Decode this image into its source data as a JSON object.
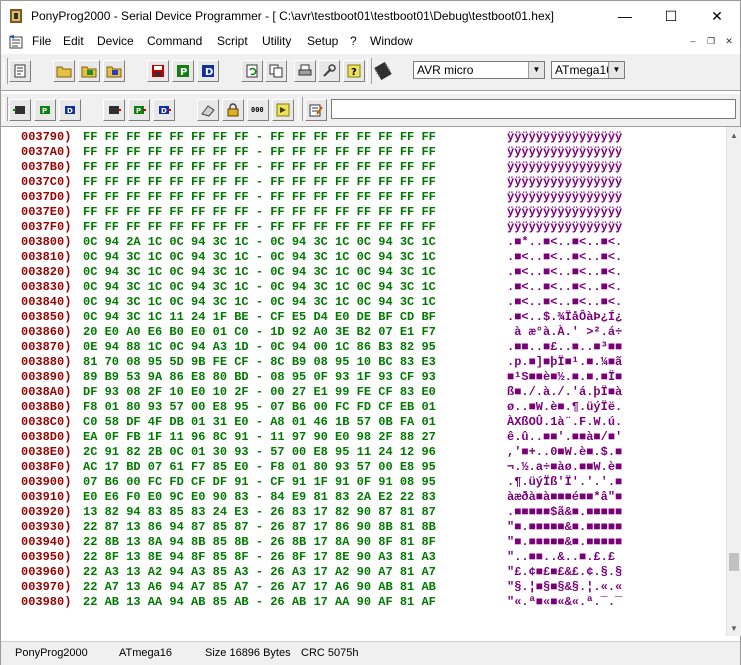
{
  "window": {
    "title": "PonyProg2000 - Serial Device Programmer - [ C:\\avr\\testboot01\\testboot01\\Debug\\testboot01.hex]",
    "minimize": "—",
    "maximize": "☐",
    "close": "✕"
  },
  "menu": {
    "items": [
      "File",
      "Edit",
      "Device",
      "Command",
      "Script",
      "Utility",
      "Setup",
      "?",
      "Window"
    ],
    "mdi_minimize": "–",
    "mdi_restore": "❐",
    "mdi_close": "✕"
  },
  "toolbar": {
    "device_family": "AVR micro",
    "device_type": "ATmega16"
  },
  "hex_rows": [
    {
      "addr": "003790)",
      "bytes": "FF FF FF FF FF FF FF FF - FF FF FF FF FF FF FF FF",
      "ascii": "ÿÿÿÿÿÿÿÿÿÿÿÿÿÿÿÿ"
    },
    {
      "addr": "0037A0)",
      "bytes": "FF FF FF FF FF FF FF FF - FF FF FF FF FF FF FF FF",
      "ascii": "ÿÿÿÿÿÿÿÿÿÿÿÿÿÿÿÿ"
    },
    {
      "addr": "0037B0)",
      "bytes": "FF FF FF FF FF FF FF FF - FF FF FF FF FF FF FF FF",
      "ascii": "ÿÿÿÿÿÿÿÿÿÿÿÿÿÿÿÿ"
    },
    {
      "addr": "0037C0)",
      "bytes": "FF FF FF FF FF FF FF FF - FF FF FF FF FF FF FF FF",
      "ascii": "ÿÿÿÿÿÿÿÿÿÿÿÿÿÿÿÿ"
    },
    {
      "addr": "0037D0)",
      "bytes": "FF FF FF FF FF FF FF FF - FF FF FF FF FF FF FF FF",
      "ascii": "ÿÿÿÿÿÿÿÿÿÿÿÿÿÿÿÿ"
    },
    {
      "addr": "0037E0)",
      "bytes": "FF FF FF FF FF FF FF FF - FF FF FF FF FF FF FF FF",
      "ascii": "ÿÿÿÿÿÿÿÿÿÿÿÿÿÿÿÿ"
    },
    {
      "addr": "0037F0)",
      "bytes": "FF FF FF FF FF FF FF FF - FF FF FF FF FF FF FF FF",
      "ascii": "ÿÿÿÿÿÿÿÿÿÿÿÿÿÿÿÿ"
    },
    {
      "addr": "003800)",
      "bytes": "0C 94 2A 1C 0C 94 3C 1C - 0C 94 3C 1C 0C 94 3C 1C",
      "ascii": ".■*..■<..■<..■<."
    },
    {
      "addr": "003810)",
      "bytes": "0C 94 3C 1C 0C 94 3C 1C - 0C 94 3C 1C 0C 94 3C 1C",
      "ascii": ".■<..■<..■<..■<."
    },
    {
      "addr": "003820)",
      "bytes": "0C 94 3C 1C 0C 94 3C 1C - 0C 94 3C 1C 0C 94 3C 1C",
      "ascii": ".■<..■<..■<..■<."
    },
    {
      "addr": "003830)",
      "bytes": "0C 94 3C 1C 0C 94 3C 1C - 0C 94 3C 1C 0C 94 3C 1C",
      "ascii": ".■<..■<..■<..■<."
    },
    {
      "addr": "003840)",
      "bytes": "0C 94 3C 1C 0C 94 3C 1C - 0C 94 3C 1C 0C 94 3C 1C",
      "ascii": ".■<..■<..■<..■<."
    },
    {
      "addr": "003850)",
      "bytes": "0C 94 3C 1C 11 24 1F BE - CF E5 D4 E0 DE BF CD BF",
      "ascii": ".■<..$.¾ÏåÔàÞ¿Í¿"
    },
    {
      "addr": "003860)",
      "bytes": "20 E0 A0 E6 B0 E0 01 C0 - 1D 92 A0 3E B2 07 E1 F7",
      "ascii": " à æ°à.À.' >².á÷"
    },
    {
      "addr": "003870)",
      "bytes": "0E 94 88 1C 0C 94 A3 1D - 0C 94 00 1C 86 B3 82 95",
      "ascii": ".■■..■£..■..■³■■"
    },
    {
      "addr": "003880)",
      "bytes": "81 70 08 95 5D 9B FE CF - 8C B9 08 95 10 BC 83 E3",
      "ascii": ".p.■]■þÏ■¹.■.¼■ã"
    },
    {
      "addr": "003890)",
      "bytes": "89 B9 53 9A 86 E8 80 BD - 08 95 0F 93 1F 93 CF 93",
      "ascii": "■¹S■■è■½.■.■.■Ï■"
    },
    {
      "addr": "0038A0)",
      "bytes": "DF 93 08 2F 10 E0 10 2F - 00 27 E1 99 FE CF 83 E0",
      "ascii": "ß■./.à./.'á.þÏ■à"
    },
    {
      "addr": "0038B0)",
      "bytes": "F8 01 80 93 57 00 E8 95 - 07 B6 00 FC FD CF EB 01",
      "ascii": "ø..■W.è■.¶.üýÏë."
    },
    {
      "addr": "0038C0)",
      "bytes": "C0 58 DF 4F DB 01 31 E0 - A8 01 46 1B 57 0B FA 01",
      "ascii": "ÀXßOÛ.1à¨.F.W.ú."
    },
    {
      "addr": "0038D0)",
      "bytes": "EA 0F FB 1F 11 96 8C 91 - 11 97 90 E0 98 2F 88 27",
      "ascii": "ê.û..■■'.■■à■/■'"
    },
    {
      "addr": "0038E0)",
      "bytes": "2C 91 82 2B 0C 01 30 93 - 57 00 E8 95 11 24 12 96",
      "ascii": ",'■+..0■W.è■.$.■"
    },
    {
      "addr": "0038F0)",
      "bytes": "AC 17 BD 07 61 F7 85 E0 - F8 01 80 93 57 00 E8 95",
      "ascii": "¬.½.a÷■àø.■■W.è■"
    },
    {
      "addr": "003900)",
      "bytes": "07 B6 00 FC FD CF DF 91 - CF 91 1F 91 0F 91 08 95",
      "ascii": ".¶.üýÏß'Ï'.'.'.■"
    },
    {
      "addr": "003910)",
      "bytes": "E0 E6 F0 E0 9C E0 90 83 - 84 E9 81 83 2A E2 22 83",
      "ascii": "àæðà■à■■■é■■*â\"■"
    },
    {
      "addr": "003920)",
      "bytes": "13 82 94 83 85 83 24 E3 - 26 83 17 82 90 87 81 87",
      "ascii": ".■■■■■$ã&■.■■■■■"
    },
    {
      "addr": "003930)",
      "bytes": "22 87 13 86 94 87 85 87 - 26 87 17 86 90 8B 81 8B",
      "ascii": "\"■.■■■■■&■.■■■■■"
    },
    {
      "addr": "003940)",
      "bytes": "22 8B 13 8A 94 8B 85 8B - 26 8B 17 8A 90 8F 81 8F",
      "ascii": "\"■.■■■■■&■.■■■■■"
    },
    {
      "addr": "003950)",
      "bytes": "22 8F 13 8E 94 8F 85 8F - 26 8F 17 8E 90 A3 81 A3",
      "ascii": "\"..■■..&..■.£.£"
    },
    {
      "addr": "003960)",
      "bytes": "22 A3 13 A2 94 A3 85 A3 - 26 A3 17 A2 90 A7 81 A7",
      "ascii": "\"£.¢■£■£&£.¢.§.§"
    },
    {
      "addr": "003970)",
      "bytes": "22 A7 13 A6 94 A7 85 A7 - 26 A7 17 A6 90 AB 81 AB",
      "ascii": "\"§.¦■§■§&§.¦.«.«"
    },
    {
      "addr": "003980)",
      "bytes": "22 AB 13 AA 94 AB 85 AB - 26 AB 17 AA 90 AF 81 AF",
      "ascii": "\"«.ª■«■«&«.ª.¯.¯"
    }
  ],
  "status": {
    "app": "PonyProg2000",
    "device": "ATmega16",
    "size": "Size 16896 Bytes",
    "crc": "CRC  5075h"
  },
  "colors": {
    "address": "#990000",
    "bytes": "#007a00",
    "ascii": "#7a007a"
  }
}
